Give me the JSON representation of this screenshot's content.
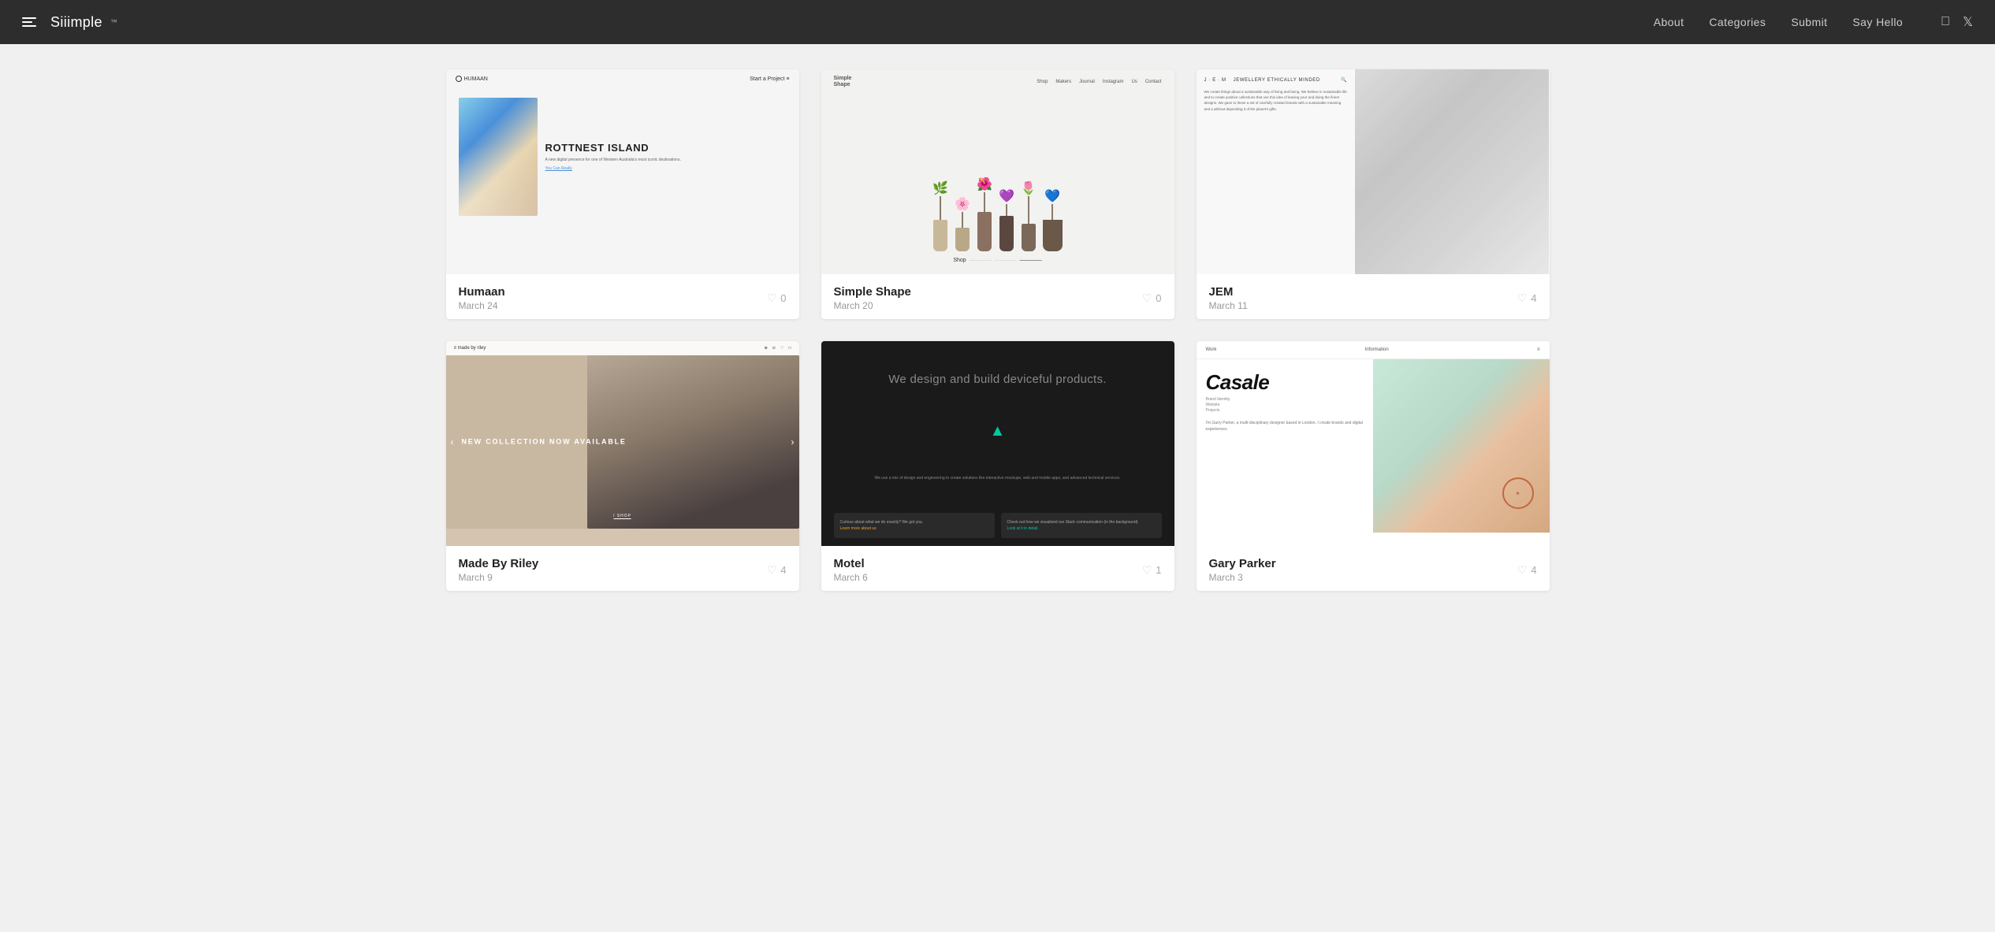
{
  "nav": {
    "brand": "Siiimple",
    "tm": "™",
    "links": [
      {
        "label": "About",
        "href": "#"
      },
      {
        "label": "Categories",
        "href": "#"
      },
      {
        "label": "Submit",
        "href": "#"
      },
      {
        "label": "Say Hello",
        "href": "#"
      }
    ],
    "social": [
      {
        "name": "facebook",
        "icon": "f",
        "href": "#"
      },
      {
        "name": "twitter",
        "icon": "𝕏",
        "href": "#"
      }
    ]
  },
  "cards": [
    {
      "id": "humaan",
      "title": "Humaan",
      "date": "March 24",
      "likes": 0,
      "preview_headline": "ROTTNEST ISLAND",
      "preview_sub": "A new digital presence for one of Western Australia's most iconic destinations."
    },
    {
      "id": "simpleshape",
      "title": "Simple Shape",
      "date": "March 20",
      "likes": 0,
      "preview_nav": [
        "Shop",
        "Makers",
        "Journal",
        "Instagram",
        "Us",
        "Contact"
      ]
    },
    {
      "id": "jem",
      "title": "JEM",
      "date": "March 11",
      "likes": 4
    },
    {
      "id": "riley",
      "title": "Made By Riley",
      "date": "March 9",
      "likes": 4,
      "preview_text": "NEW COLLECTION NOW AVAILABLE"
    },
    {
      "id": "motel",
      "title": "Motel",
      "date": "March 6",
      "likes": 1,
      "preview_headline": "We design and build deviceful products.",
      "preview_sub": "We use a mix of design and engineering to create solutions like interactive mockups, web and mobile apps, and advanced technical services.",
      "card1_title": "Curious about what we do exactly? We got you.",
      "card1_link": "Learn more about us",
      "card2_title": "Check out how we visualized our Slack communication (in the background).",
      "card2_link": "Look at it in detail."
    },
    {
      "id": "gary",
      "title": "Gary Parker",
      "date": "March 3",
      "likes": 4,
      "preview_logo": "Casale",
      "preview_nav_left": "Work",
      "preview_nav_right": "Information",
      "preview_bio": "I'm Garry Parker, a multi-disciplinary designer based in London. I create brands and digital experiences."
    }
  ]
}
